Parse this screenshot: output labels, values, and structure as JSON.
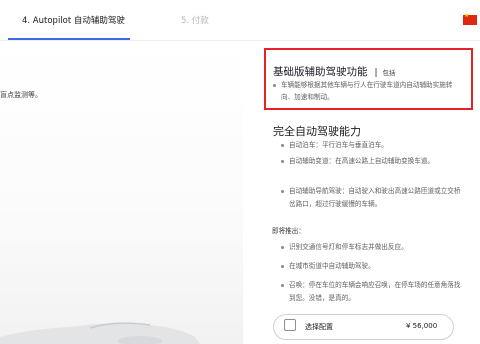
{
  "steps": {
    "active_label": "4. Autopilot 自动辅助驾驶",
    "next_label": "5. 付款"
  },
  "region": {
    "icon": "china-flag-icon"
  },
  "left": {
    "snippet": "盲点监测等。"
  },
  "basic": {
    "title": "基础版辅助驾驶功能",
    "separator": "|",
    "included": "包括",
    "desc": "车辆能够根据其他车辆与行人在行驶车道内自动辅助实施转向、加速和制动。"
  },
  "fsd": {
    "title": "完全自动驾驶能力",
    "features": [
      "自动泊车：平行泊车与垂直泊车。",
      "自动辅助变道：在高速公路上自动辅助变换车道。",
      "自动辅助导航驾驶：自动驶入和驶出高速公路匝道或立交桥岔路口，超过行驶缓慢的车辆。"
    ],
    "coming_soon_label": "即将推出：",
    "coming": [
      "识别交通信号灯和停车标志并做出反应。",
      "在城市街道中自动辅助驾驶。",
      "召唤：停在车位的车辆会响应召唤，在停车场的任意角落找到您。没错，是真的。"
    ]
  },
  "config": {
    "label": "选择配置",
    "price": "¥ 56,000"
  },
  "colors": {
    "accent": "#3e6ae1",
    "highlight_border": "#e82127",
    "text_primary": "#171a20",
    "text_secondary": "#5c5e62"
  }
}
